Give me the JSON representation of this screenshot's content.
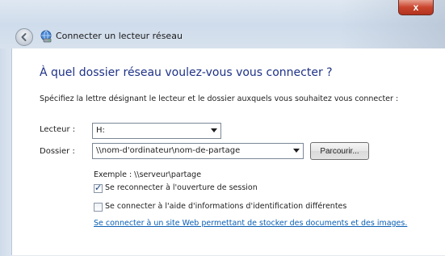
{
  "window": {
    "title": "Connecter un lecteur réseau",
    "close_glyph": "x"
  },
  "dialog": {
    "heading": "À quel dossier réseau voulez-vous vous connecter ?",
    "instruction": "Spécifiez la lettre désignant le lecteur et le dossier auxquels vous souhaitez vous connecter :",
    "drive": {
      "label": "Lecteur :",
      "value": "H:"
    },
    "folder": {
      "label": "Dossier :",
      "value": "\\\\nom-d'ordinateur\\nom-de-partage"
    },
    "browse_label": "Parcourir...",
    "example": "Exemple : \\\\serveur\\partage",
    "reconnect": {
      "label": "Se reconnecter à l'ouverture de session",
      "checked": true
    },
    "other_credentials": {
      "label": "Se connecter à l'aide d'informations d'identification différentes",
      "checked": false
    },
    "web_link": "Se connecter à un site Web permettant de stocker des documents et des images."
  },
  "colors": {
    "heading": "#1e3287",
    "link": "#0b5fb4",
    "close_button": "#c9452d"
  },
  "icons": [
    "back-arrow-icon",
    "network-drive-icon",
    "chevron-down-icon",
    "checkmark-icon"
  ]
}
